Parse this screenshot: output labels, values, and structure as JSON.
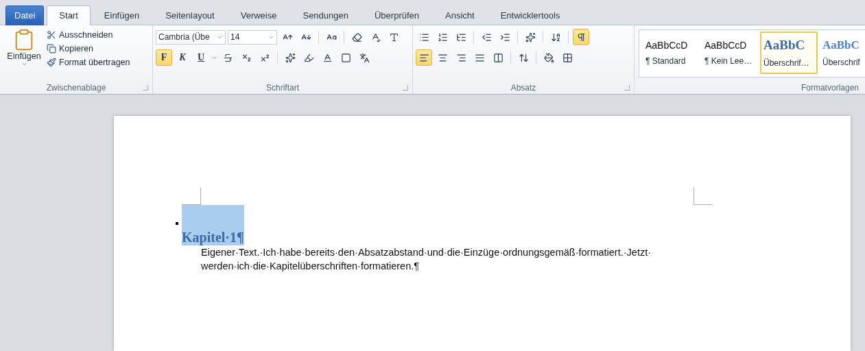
{
  "tabs": [
    {
      "label": "Datei",
      "kind": "file",
      "selected": false
    },
    {
      "label": "Start",
      "kind": "tab",
      "selected": true
    },
    {
      "label": "Einfügen",
      "kind": "tab",
      "selected": false
    },
    {
      "label": "Seitenlayout",
      "kind": "tab",
      "selected": false
    },
    {
      "label": "Verweise",
      "kind": "tab",
      "selected": false
    },
    {
      "label": "Sendungen",
      "kind": "tab",
      "selected": false
    },
    {
      "label": "Überprüfen",
      "kind": "tab",
      "selected": false
    },
    {
      "label": "Ansicht",
      "kind": "tab",
      "selected": false
    },
    {
      "label": "Entwicklertools",
      "kind": "tab",
      "selected": false
    }
  ],
  "clipboard": {
    "paste": "Einfügen",
    "actions": [
      "Ausschneiden",
      "Kopieren",
      "Format übertragen"
    ],
    "label": "Zwischenablage"
  },
  "font": {
    "name": "Cambria (Übe",
    "size": "14",
    "styles": [
      {
        "label": "F",
        "selected": true
      },
      {
        "label": "K",
        "selected": false
      },
      {
        "label": "U",
        "selected": false
      }
    ],
    "label": "Schriftart"
  },
  "paragraph": {
    "alignments": [
      {
        "selected": true
      },
      {
        "selected": false
      },
      {
        "selected": false
      },
      {
        "selected": false
      },
      {
        "selected": false
      }
    ],
    "show_marks": {
      "selected": true
    },
    "label": "Absatz"
  },
  "styles": {
    "items": [
      {
        "preview": "AaBbCcD",
        "label": "¶ Standard",
        "kind": "normal",
        "selected": false
      },
      {
        "preview": "AaBbCcD",
        "label": "¶ Kein Lee…",
        "kind": "normal",
        "selected": false
      },
      {
        "preview": "AaBbC",
        "label": "Überschrif…",
        "kind": "heading1",
        "selected": true
      },
      {
        "preview": "AaBbC",
        "label": "Überschrif",
        "kind": "heading2",
        "selected": false
      }
    ],
    "label": "Formatvorlagen"
  },
  "document": {
    "heading": "Kapitel·1¶",
    "selected": true,
    "body": [
      "Eigener·Text.·Ich·habe·bereits·den·Absatzabstand·und·die·Einzüge·ordnungsgemäß·formatiert.·Jetzt·",
      "werden·ich·die·Kapitelüberschriften·formatieren.¶"
    ]
  }
}
